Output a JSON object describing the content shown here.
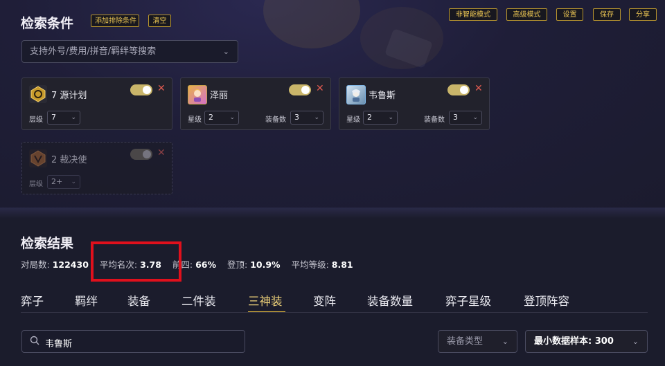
{
  "conditions": {
    "title": "检索条件",
    "add_exclude_label": "添加排除条件",
    "clear_label": "清空",
    "search_placeholder": "支持外号/费用/拼音/羁绊等搜索",
    "search_chevron_icon": "chevron-down-icon",
    "top_buttons": [
      "非智能模式",
      "高级模式",
      "设置",
      "保存",
      "分享"
    ]
  },
  "cards": [
    {
      "name": "7 源计划",
      "icon": "trait-hexagon-icon",
      "field1_label": "层级",
      "field1_value": "7",
      "enabled": true
    },
    {
      "name": "泽丽",
      "icon": "champion-portrait",
      "field1_label": "星级",
      "field1_value": "2",
      "field2_label": "装备数",
      "field2_value": "3",
      "enabled": true
    },
    {
      "name": "韦鲁斯",
      "icon": "champion-portrait",
      "field1_label": "星级",
      "field1_value": "2",
      "field2_label": "装备数",
      "field2_value": "3",
      "enabled": true
    },
    {
      "name": "2 裁决使",
      "icon": "trait-hexagon-icon",
      "field1_label": "层级",
      "field1_value": "2+",
      "enabled": false
    }
  ],
  "results": {
    "title": "检索结果",
    "stats": [
      {
        "label": "对局数:",
        "value": "122430"
      },
      {
        "label": "平均名次:",
        "value": "3.78"
      },
      {
        "label": "前四:",
        "value": "66%"
      },
      {
        "label": "登顶:",
        "value": "10.9%"
      },
      {
        "label": "平均等级:",
        "value": "8.81"
      }
    ],
    "tabs": [
      "弈子",
      "羁绊",
      "装备",
      "二件装",
      "三神装",
      "变阵",
      "装备数量",
      "弈子星级",
      "登顶阵容"
    ],
    "active_tab": "三神装",
    "search_value": "韦鲁斯",
    "equip_type_label": "装备类型",
    "min_sample_label": "最小数据样本:",
    "min_sample_value": "300"
  },
  "colors": {
    "accent": "#d9b13a",
    "highlight": "#e0101c",
    "close": "#e05a50"
  }
}
